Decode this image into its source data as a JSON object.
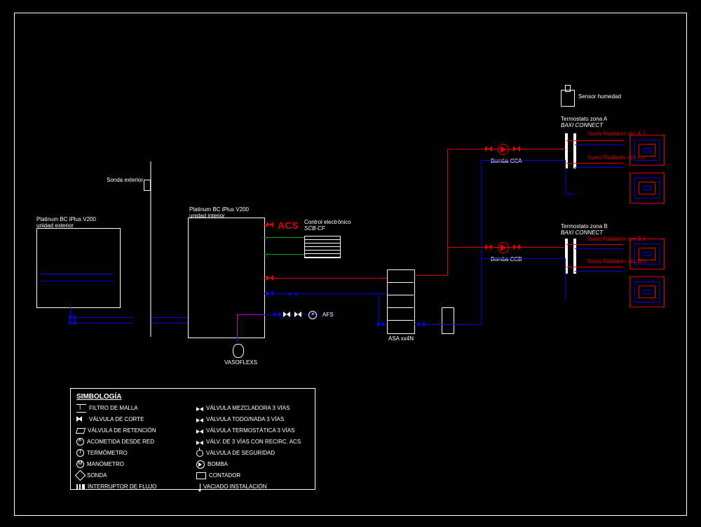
{
  "equipment": {
    "outdoor_unit": {
      "line1": "Platinum BC iPlus V200",
      "line2": "unidad exterior"
    },
    "indoor_unit": {
      "line1": "Platinum BC iPlus V200",
      "line2": "unidad interior"
    },
    "exterior_probe": "Sonda exterior",
    "acs": "ACS",
    "control": {
      "line1": "Control electrónico",
      "line2": "SCB-CF"
    },
    "afs": "AFS",
    "vasoflex": "VASOFLEXS",
    "buffer": "ASA xx4N",
    "humidity_sensor": "Sensor humedad"
  },
  "zones": {
    "pump_a": "Bomba CCA",
    "pump_b": "Bomba CCB",
    "thermo_a": {
      "line1": "Termostato zona A",
      "line2": "BAXI CONNECT"
    },
    "thermo_b": {
      "line1": "Termostato zona B",
      "line2": "BAXI CONNECT"
    },
    "rad_a1": "Suelo Radiante circ A.1",
    "rad_an": "Suelo Radiante circ A.n",
    "rad_b1": "Suelo Radiante circ B.1",
    "rad_bn": "Suelo Radiante circ B.n"
  },
  "legend": {
    "title": "SIMBOLOGÍA",
    "col1": [
      "FILTRO DE MALLA",
      "VÁLVULA DE CORTE",
      "VÁLVULA DE RETENCIÓN",
      "ACOMETIDA DESDE RED",
      "TERMÓMETRO",
      "MANÓMETRO",
      "SONDA",
      "INTERRUPTOR DE FLUJO"
    ],
    "col2": [
      "VÁLVULA MEZCLADORA 3 VÍAS",
      "VÁLVULA TODO/NADA 3 VÍAS",
      "VÁLVULA TERMOSTÁTICA 3 VÍAS",
      "VÁLV. DE 3 VÍAS CON RECIRC. ACS",
      "VÁLVULA DE SEGURIDAD",
      "BOMBA",
      "CONTADOR",
      "VACIADO INSTALACIÓN"
    ]
  }
}
